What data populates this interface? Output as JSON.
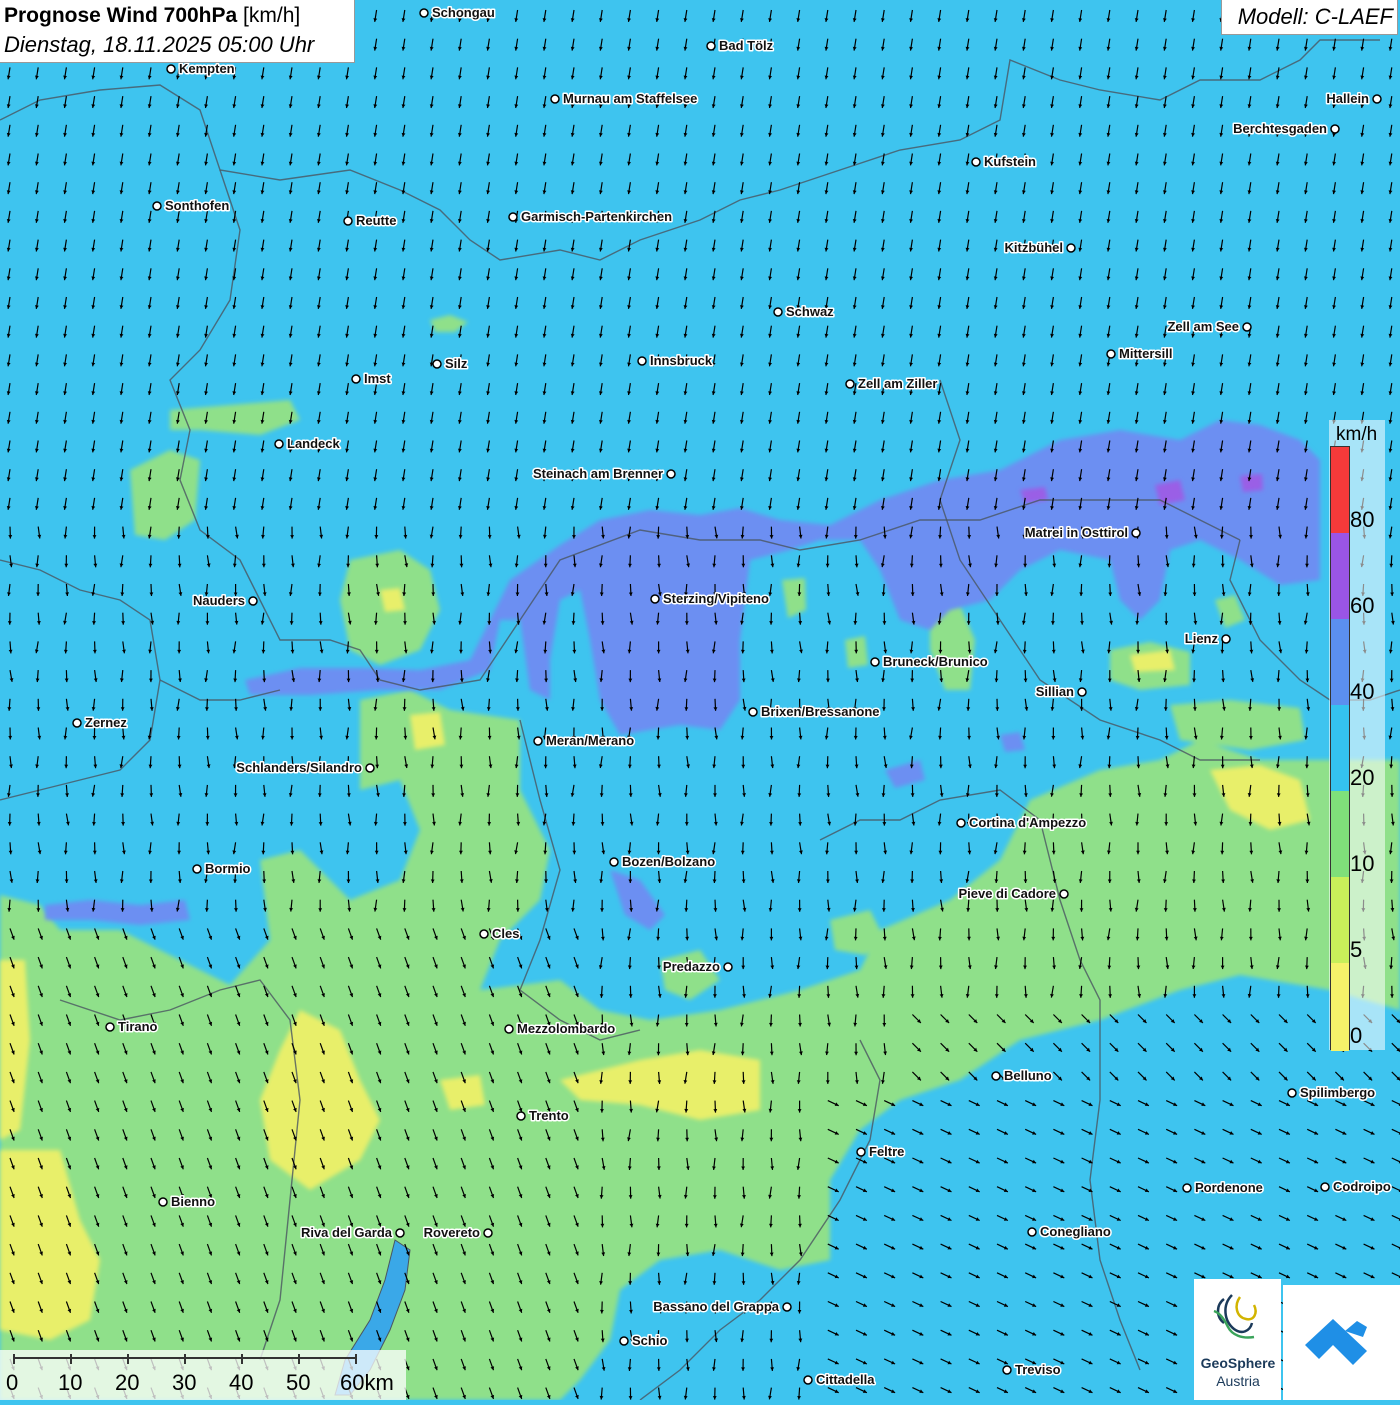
{
  "header": {
    "title_bold": "Prognose Wind 700hPa",
    "title_unit": " [km/h]",
    "datetime": "Dienstag, 18.11.2025 05:00 Uhr",
    "model": "Modell: C-LAEF"
  },
  "legend": {
    "unit": "km/h",
    "labels": [
      "80",
      "60",
      "40",
      "20",
      "10",
      "5",
      "0"
    ],
    "colors": [
      "#f53a3a",
      "#9a55e6",
      "#5b8ff0",
      "#34c2f0",
      "#7fe07a",
      "#c8f05a",
      "#f6f36a"
    ]
  },
  "scale": {
    "labels": [
      "0",
      "10",
      "20",
      "30",
      "40",
      "50",
      "60km"
    ]
  },
  "logos": {
    "geosphere_line1": "GeoSphere",
    "geosphere_line2": "Austria"
  },
  "colors": {
    "background": "#3ec4ef",
    "band_blue": "#6c8ff2",
    "band_purple": "#8e63e8",
    "band_green": "#8fe08a",
    "band_yellow": "#e8ef6a",
    "arrow": "#000000"
  },
  "cities": [
    {
      "name": "Schongau"
    },
    {
      "name": "Bad Tölz"
    },
    {
      "name": "Kempten"
    },
    {
      "name": "Murnau am Staffelsee"
    },
    {
      "name": "Hallein"
    },
    {
      "name": "Berchtesgaden"
    },
    {
      "name": "Kufstein"
    },
    {
      "name": "Sonthofen"
    },
    {
      "name": "Reutte"
    },
    {
      "name": "Garmisch-Partenkirchen"
    },
    {
      "name": "Kitzbühel"
    },
    {
      "name": "Schwaz"
    },
    {
      "name": "Zell am See"
    },
    {
      "name": "Mittersill"
    },
    {
      "name": "Imst"
    },
    {
      "name": "Silz"
    },
    {
      "name": "Innsbruck"
    },
    {
      "name": "Zell am Ziller"
    },
    {
      "name": "Landeck"
    },
    {
      "name": "Steinach am Brenner"
    },
    {
      "name": "Matrei in Osttirol"
    },
    {
      "name": "Nauders"
    },
    {
      "name": "Sterzing/Vipiteno"
    },
    {
      "name": "Lienz"
    },
    {
      "name": "Bruneck/Brunico"
    },
    {
      "name": "Sillian"
    },
    {
      "name": "Zernez"
    },
    {
      "name": "Brixen/Bressanone"
    },
    {
      "name": "Meran/Merano"
    },
    {
      "name": "Schlanders/Silandro"
    },
    {
      "name": "Cortina d'Ampezzo"
    },
    {
      "name": "Bozen/Bolzano"
    },
    {
      "name": "Bormio"
    },
    {
      "name": "Pieve di Cadore"
    },
    {
      "name": "Cles"
    },
    {
      "name": "Predazzo"
    },
    {
      "name": "Tirano"
    },
    {
      "name": "Mezzolombardo"
    },
    {
      "name": "Belluno"
    },
    {
      "name": "Spilimbergo"
    },
    {
      "name": "Trento"
    },
    {
      "name": "Feltre"
    },
    {
      "name": "Pordenone"
    },
    {
      "name": "Codroipo"
    },
    {
      "name": "Bienno"
    },
    {
      "name": "Riva del Garda"
    },
    {
      "name": "Rovereto"
    },
    {
      "name": "Conegliano"
    },
    {
      "name": "Bassano del Grappa"
    },
    {
      "name": "Schio"
    },
    {
      "name": "Treviso"
    },
    {
      "name": "Cittadella"
    }
  ]
}
